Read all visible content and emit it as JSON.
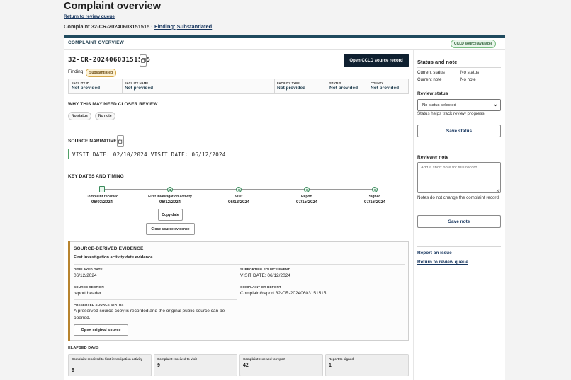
{
  "page": {
    "title": "Complaint overview",
    "back_link": "Return to review queue",
    "subtitle_prefix": "Complaint 32-CR-20240603151515 · ",
    "subtitle_finding_label": "Finding:",
    "subtitle_finding_value": "Substantiated"
  },
  "card": {
    "heading": "COMPLAINT OVERVIEW",
    "ccld_badge": "CCLD source available",
    "case_id": "32-CR-20240603151515",
    "finding_label": "Finding",
    "finding_badge": "Substantiated",
    "open_source_button": "Open CCLD source record"
  },
  "facility": [
    {
      "key": "FACILITY ID",
      "value": "Not provided"
    },
    {
      "key": "FACILITY NAME",
      "value": "Not provided"
    },
    {
      "key": "FACILITY TYPE",
      "value": "Not provided"
    },
    {
      "key": "STATUS",
      "value": "Not provided"
    },
    {
      "key": "COUNTY",
      "value": "Not provided"
    }
  ],
  "why": {
    "label": "WHY THIS MAY NEED CLOSER REVIEW",
    "pills": [
      "No status",
      "No note"
    ]
  },
  "narrative": {
    "label": "SOURCE NARRATIVE",
    "text": "VISIT DATE: 02/10/2024 VISIT DATE: 06/12/2024"
  },
  "timeline": {
    "label": "KEY DATES AND TIMING",
    "events": [
      {
        "label": "Complaint received",
        "date": "06/03/2024",
        "icon": "document-icon"
      },
      {
        "label": "First investigation activity",
        "date": "06/12/2024",
        "icon": "circle-dot-icon"
      },
      {
        "label": "Visit",
        "date": "06/12/2024",
        "icon": "circle-dot-icon"
      },
      {
        "label": "Report",
        "date": "07/15/2024",
        "icon": "circle-dot-icon"
      },
      {
        "label": "Signed",
        "date": "07/16/2024",
        "icon": "circle-dot-icon"
      }
    ],
    "copy_date_button": "Copy date",
    "close_evidence_button": "Close source evidence"
  },
  "evidence": {
    "title": "SOURCE-DERIVED EVIDENCE",
    "subtitle": "First investigation activity date evidence",
    "displayed_date_key": "DISPLAYED DATE",
    "displayed_date_value": "06/12/2024",
    "supporting_event_key": "SUPPORTING SOURCE EVENT",
    "supporting_event_value": "VISIT DATE: 06/12/2024",
    "source_section_key": "SOURCE SECTION",
    "source_section_value": "report header",
    "complaint_report_key": "COMPLAINT OR REPORT",
    "complaint_report_value": "Complaint/report 32-CR-20240603151515",
    "preserved_key": "PRESERVED SOURCE STATUS",
    "preserved_value": "A preserved source copy is recorded and the original public source can be opened.",
    "open_original_button": "Open original source"
  },
  "elapsed": {
    "label": "ELAPSED DAYS",
    "items": [
      {
        "key": "Complaint received to first investigation activity",
        "value": "9"
      },
      {
        "key": "Complaint received to visit",
        "value": "9"
      },
      {
        "key": "Complaint received to report",
        "value": "42"
      },
      {
        "key": "Report to signed",
        "value": "1"
      }
    ]
  },
  "sidebar": {
    "status_title": "Status and note",
    "current_status_key": "Current status",
    "current_status_value": "No status",
    "current_note_key": "Current note",
    "current_note_value": "No note",
    "review_status_label": "Review status",
    "review_status_selected": "No status selected",
    "review_status_help": "Status helps track review progress.",
    "save_status_button": "Save status",
    "reviewer_note_label": "Reviewer note",
    "reviewer_note_placeholder": "Add a short note for this record",
    "reviewer_note_help": "Notes do not change the complaint record.",
    "save_note_button": "Save note",
    "report_issue_link": "Report an issue",
    "return_queue_link": "Return to review queue"
  }
}
